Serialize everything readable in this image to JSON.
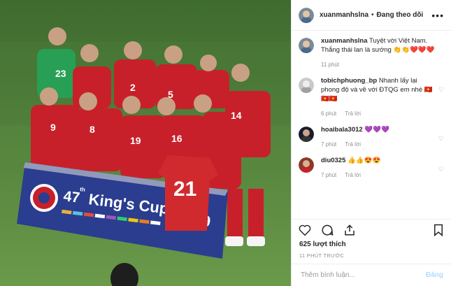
{
  "header": {
    "username": "xuanmanhslna",
    "separator": "•",
    "follow_label": "Đang theo dõi",
    "more_label": "•••"
  },
  "caption": {
    "username": "xuanmanhslna",
    "text": "Tuyệt vời Việt Nam. Thắng thái lan là sướng 👏👏❤️❤️❤️",
    "time": "11 phút"
  },
  "comments": [
    {
      "username": "tobichphuong_bp",
      "text": "Nhanh lấy lại phong độ và về với ĐTQG em nhé 🇻🇳🇻🇳🇻🇳",
      "time": "6 phút",
      "reply": "Trả lời"
    },
    {
      "username": "hoaibala3012",
      "text": "💜💜💜",
      "time": "7 phút",
      "reply": "Trả lời"
    },
    {
      "username": "diu0325",
      "text": "👍👍😍😍",
      "time": "7 phút",
      "reply": "Trả lời"
    }
  ],
  "likes": "625 lượt thích",
  "timestamp": "11 PHÚT TRƯỚC",
  "add_comment": {
    "placeholder": "Thêm bình luận...",
    "post_label": "Đăng"
  },
  "photo": {
    "banner_number": "47",
    "banner_suffix": "th",
    "banner_text": "King's Cup",
    "banner_edge": "9",
    "shirt_number": "21",
    "jersey_numbers": [
      "23",
      "2",
      "5",
      "9",
      "8",
      "19",
      "16",
      "14"
    ]
  },
  "colors": {
    "text": "#262626",
    "muted": "#8e8e8e",
    "grass": "#4d7a3a",
    "kit": "#c8202a",
    "banner": "#2a3d8f",
    "post": "#b3dbff"
  }
}
